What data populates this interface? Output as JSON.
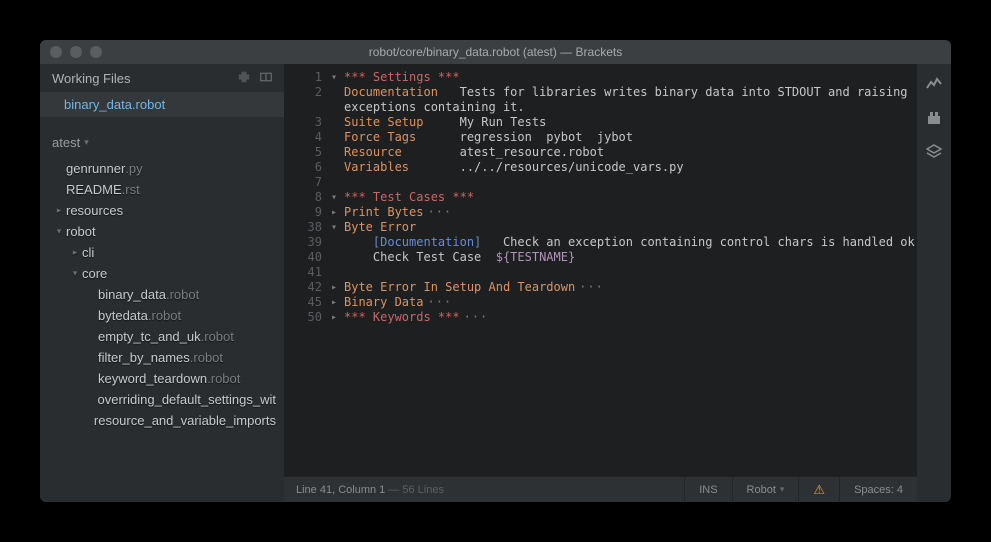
{
  "titlebar": {
    "title": "robot/core/binary_data.robot (atest) — Brackets"
  },
  "workingFiles": {
    "header": "Working Files",
    "items": [
      "binary_data.robot"
    ]
  },
  "project": {
    "name": "atest",
    "tree": [
      {
        "lvl": 0,
        "tw": "",
        "n1": "genrunner",
        "n2": ".py"
      },
      {
        "lvl": 0,
        "tw": "",
        "n1": "README",
        "n2": ".rst"
      },
      {
        "lvl": 0,
        "tw": "▸",
        "n1": "resources",
        "n2": ""
      },
      {
        "lvl": 0,
        "tw": "▾",
        "n1": "robot",
        "n2": ""
      },
      {
        "lvl": 1,
        "tw": "▸",
        "n1": "cli",
        "n2": ""
      },
      {
        "lvl": 1,
        "tw": "▾",
        "n1": "core",
        "n2": ""
      },
      {
        "lvl": 2,
        "tw": "",
        "n1": "binary_data",
        "n2": ".robot"
      },
      {
        "lvl": 2,
        "tw": "",
        "n1": "bytedata",
        "n2": ".robot"
      },
      {
        "lvl": 2,
        "tw": "",
        "n1": "empty_tc_and_uk",
        "n2": ".robot"
      },
      {
        "lvl": 2,
        "tw": "",
        "n1": "filter_by_names",
        "n2": ".robot"
      },
      {
        "lvl": 2,
        "tw": "",
        "n1": "keyword_teardown",
        "n2": ".robot"
      },
      {
        "lvl": 2,
        "tw": "",
        "n1": "overriding_default_settings_wit",
        "n2": ""
      },
      {
        "lvl": 2,
        "tw": "",
        "n1": "resource_and_variable_imports",
        "n2": ""
      }
    ]
  },
  "code": {
    "gutter": [
      {
        "n": "1",
        "f": "▾"
      },
      {
        "n": "2",
        "f": ""
      },
      {
        "n": "",
        "f": ""
      },
      {
        "n": "3",
        "f": ""
      },
      {
        "n": "4",
        "f": ""
      },
      {
        "n": "5",
        "f": ""
      },
      {
        "n": "6",
        "f": ""
      },
      {
        "n": "7",
        "f": ""
      },
      {
        "n": "8",
        "f": "▾"
      },
      {
        "n": "9",
        "f": "▸"
      },
      {
        "n": "38",
        "f": "▾"
      },
      {
        "n": "39",
        "f": ""
      },
      {
        "n": "40",
        "f": ""
      },
      {
        "n": "41",
        "f": ""
      },
      {
        "n": "42",
        "f": "▸"
      },
      {
        "n": "45",
        "f": "▸"
      },
      {
        "n": "50",
        "f": "▸"
      }
    ],
    "lines": {
      "l0": "*** Settings ***",
      "l1a": "Documentation",
      "l1b": "   Tests for libraries writes binary data into STDOUT and raising",
      "l2": "exceptions containing it.",
      "l3a": "Suite Setup",
      "l3b": "     My Run Tests",
      "l4a": "Force Tags",
      "l4b": "      regression  pybot  jybot",
      "l5a": "Resource",
      "l5b": "        atest_resource.robot",
      "l6a": "Variables",
      "l6b": "       ../../resources/unicode_vars.py",
      "l8": "*** Test Cases ***",
      "l9": "Print Bytes",
      "l10": "Byte Error",
      "l11a": "    ",
      "l11b": "[Documentation]",
      "l11c": "   Check an exception containing control chars is handled ok",
      "l12a": "    Check Test Case  ",
      "l12b": "${TESTNAME}",
      "l14": "Byte Error In Setup And Teardown",
      "l15": "Binary Data",
      "l16": "*** Keywords ***",
      "ell": "···"
    }
  },
  "status": {
    "pos": "Line 41, Column 1",
    "lines": " — 56 Lines",
    "ins": "INS",
    "lang": "Robot",
    "spaces": "Spaces:  4"
  }
}
